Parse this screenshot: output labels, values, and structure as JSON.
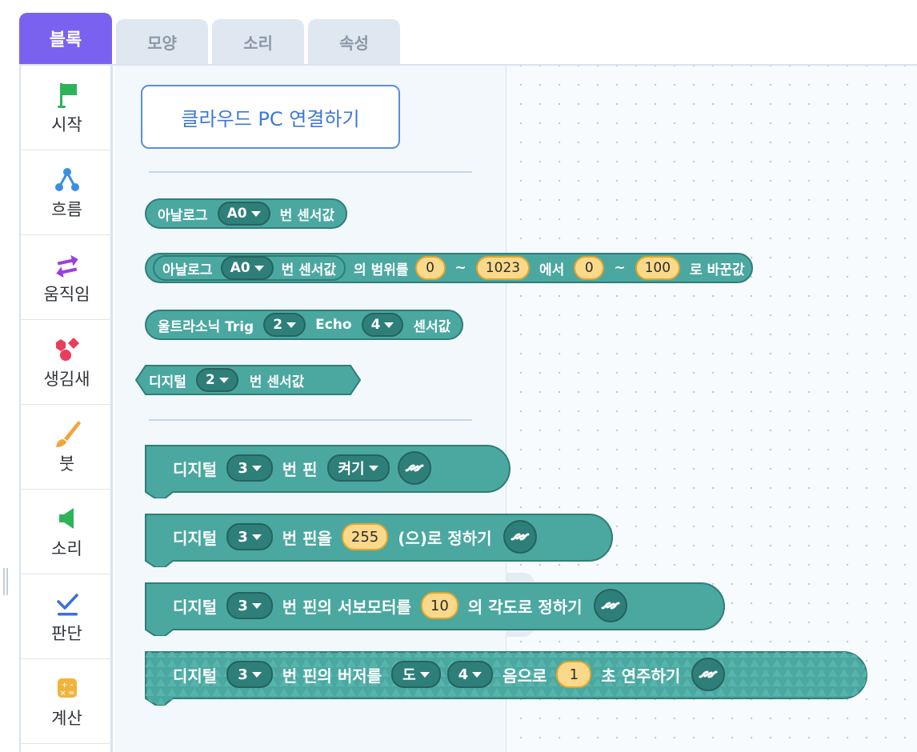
{
  "tabs": [
    {
      "label": "블록",
      "active": true
    },
    {
      "label": "모양",
      "active": false
    },
    {
      "label": "소리",
      "active": false
    },
    {
      "label": "속성",
      "active": false
    }
  ],
  "categories": [
    {
      "label": "시작",
      "icon": "flag-icon"
    },
    {
      "label": "흐름",
      "icon": "flow-icon"
    },
    {
      "label": "움직임",
      "icon": "move-arrows-icon"
    },
    {
      "label": "생김새",
      "icon": "shapes-icon"
    },
    {
      "label": "붓",
      "icon": "brush-icon"
    },
    {
      "label": "소리",
      "icon": "speaker-icon"
    },
    {
      "label": "판단",
      "icon": "check-icon"
    },
    {
      "label": "계산",
      "icon": "calculator-icon"
    }
  ],
  "palette": {
    "connect_button": "클라우드 PC 연결하기",
    "blocks": {
      "analog_read": {
        "t1": "아날로그",
        "pin": "A0",
        "t2": "번 센서값"
      },
      "analog_map": {
        "t1": "아날로그",
        "pin": "A0",
        "t2": "번 센서값",
        "t3": "의 범위를",
        "a": "0",
        "tilde1": "~",
        "b": "1023",
        "t4": "에서",
        "c": "0",
        "tilde2": "~",
        "d": "100",
        "t5": "로 바꾼값"
      },
      "ultrasonic": {
        "t1": "울트라소닉 Trig",
        "trig": "2",
        "t2": "Echo",
        "echo": "4",
        "t3": "센서값"
      },
      "digital_read": {
        "t1": "디지털",
        "pin": "2",
        "t2": "번 센서값"
      },
      "digital_write": {
        "t1": "디지털",
        "pin": "3",
        "t2": "번 핀",
        "state": "켜기"
      },
      "pwm_write": {
        "t1": "디지털",
        "pin": "3",
        "t2": "번 핀을",
        "value": "255",
        "t3": "(으)로 정하기"
      },
      "servo": {
        "t1": "디지털",
        "pin": "3",
        "t2": "번 핀의 서보모터를",
        "value": "10",
        "t3": "의 각도로 정하기"
      },
      "buzzer": {
        "t1": "디지털",
        "pin": "3",
        "t2": "번 핀의 버저를",
        "note": "도",
        "octave": "4",
        "t3": "음으로",
        "seconds": "1",
        "t4": "초 연주하기"
      }
    }
  },
  "colors": {
    "tab_active": "#7b61f0",
    "block_fill": "#4aa8a1",
    "block_border": "#2f7d78",
    "dropdown_fill": "#2e7f79",
    "number_fill": "#fbd98a",
    "connect_text": "#3d78d6"
  }
}
